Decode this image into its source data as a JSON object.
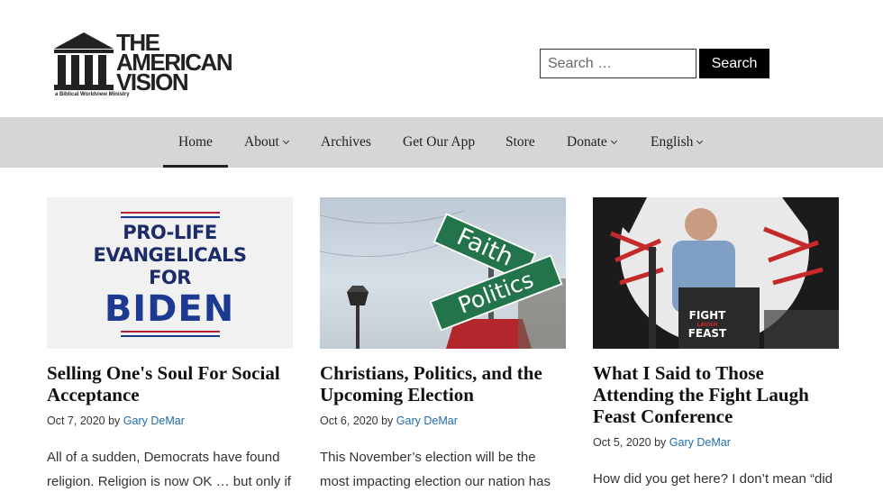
{
  "header": {
    "logo": {
      "title_lines": [
        "THE",
        "AMERICAN",
        "VISION"
      ],
      "tagline": "a Biblical Worldview Ministry"
    },
    "search": {
      "placeholder": "Search …",
      "button_label": "Search"
    }
  },
  "nav": {
    "items": [
      {
        "label": "Home",
        "active": true,
        "has_dropdown": false
      },
      {
        "label": "About",
        "active": false,
        "has_dropdown": true
      },
      {
        "label": "Archives",
        "active": false,
        "has_dropdown": false
      },
      {
        "label": "Get Our App",
        "active": false,
        "has_dropdown": false
      },
      {
        "label": "Store",
        "active": false,
        "has_dropdown": false
      },
      {
        "label": "Donate",
        "active": false,
        "has_dropdown": true
      },
      {
        "label": "English",
        "active": false,
        "has_dropdown": true
      }
    ]
  },
  "posts": [
    {
      "image_text": {
        "lines": [
          "PRO-LIFE",
          "EVANGELICALS",
          "FOR"
        ],
        "big": "BIDEN"
      },
      "title": "Selling One's Soul For Social Acceptance",
      "date": "Oct 7, 2020",
      "by": "by",
      "author": "Gary DeMar",
      "excerpt": "All of a sudden, Democrats have found religion. Religion is now OK … but only if"
    },
    {
      "image_text": {
        "sign1": "Faith",
        "sign2": "Politics"
      },
      "title": "Christians, Politics, and the Upcoming Election",
      "date": "Oct 6, 2020",
      "by": "by",
      "author": "Gary DeMar",
      "excerpt": "This November’s election will be the most impacting election our nation has"
    },
    {
      "image_text": {
        "podium": [
          "FIGHT",
          "LAUGH",
          "FEAST"
        ]
      },
      "title": "What I Said to Those Attending the Fight Laugh Feast Conference",
      "date": "Oct 5, 2020",
      "by": "by",
      "author": "Gary DeMar",
      "excerpt": "How did you get here? I don’t mean “did"
    }
  ],
  "colors": {
    "nav_bg": "#d6d6d6",
    "link": "#1f6bb0",
    "search_button": "#000000"
  }
}
